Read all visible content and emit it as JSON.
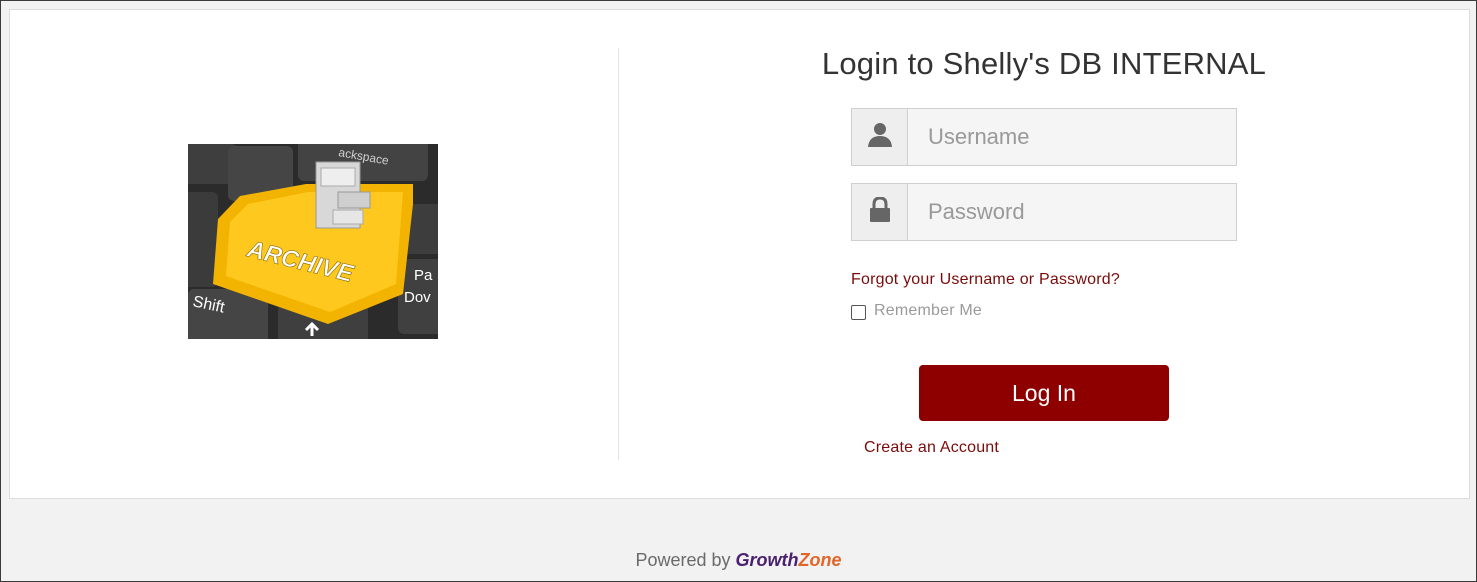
{
  "page": {
    "title": "Login to Shelly's DB INTERNAL"
  },
  "logo": {
    "keys": {
      "backspace": "ackspace",
      "archive": "ARCHIVE",
      "shift": "Shift",
      "page": "Pa",
      "down": "Dov"
    }
  },
  "form": {
    "username": {
      "placeholder": "Username",
      "value": "",
      "icon": "user-icon"
    },
    "password": {
      "placeholder": "Password",
      "value": "",
      "icon": "lock-icon"
    },
    "forgot_link": "Forgot your Username or Password?",
    "remember_label": "Remember Me",
    "remember_checked": false,
    "login_label": "Log In",
    "create_account_link": "Create an Account"
  },
  "footer": {
    "powered_by": "Powered by",
    "brand_part1": "Growth",
    "brand_part2": "Zone"
  },
  "colors": {
    "accent": "#8e0000",
    "link": "#7a0c0c",
    "brand_purple": "#4b1f6f",
    "brand_orange": "#e2662a"
  }
}
